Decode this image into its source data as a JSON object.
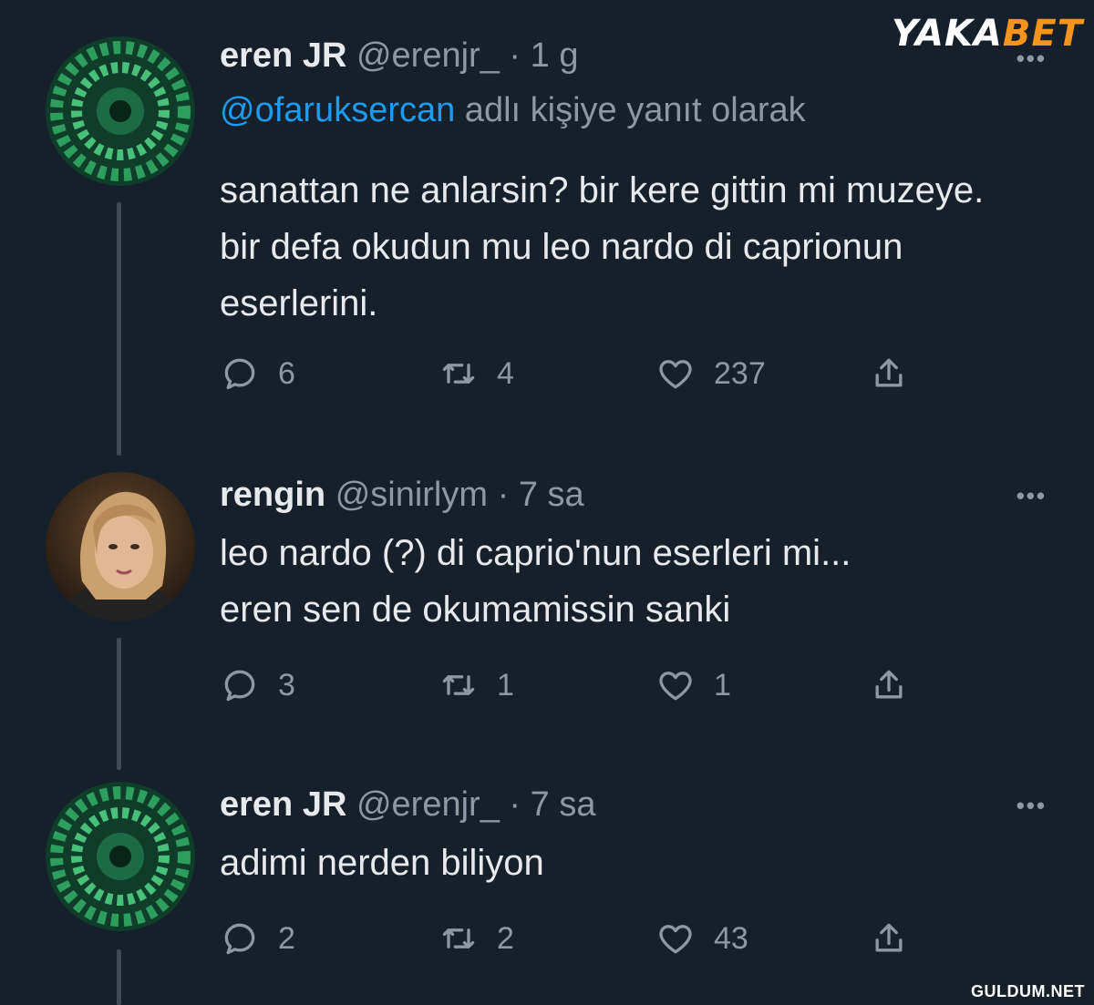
{
  "brand": {
    "logo_white": "YAKA",
    "logo_orange": "BET",
    "accent": "#f7941d"
  },
  "watermark": "GULDUM.NET",
  "colors": {
    "background": "#15202b",
    "mention": "#1d9bf0",
    "muted": "#8b98a5",
    "text": "#e7e9ea"
  },
  "tweets": [
    {
      "name": "eren JR",
      "handle": "@erenjr_",
      "sep": "·",
      "time": "1 g",
      "reply_prefix": "@ofaruksercan",
      "reply_suffix": " adlı kişiye yanıt olarak",
      "text": "sanattan ne anlarsin? bir kere gittin mi muzeye. bir defa okudun mu leo nardo di caprionun eserlerini.",
      "replies": "6",
      "retweets": "4",
      "likes": "237",
      "avatar_icon": "green-spiral-staircase-avatar"
    },
    {
      "name": "rengin",
      "handle": "@sinirlym",
      "sep": "·",
      "time": "7 sa",
      "text_line1": "leo nardo (?) di caprio'nun eserleri mi...",
      "text_line2": "eren sen de okumamissin sanki",
      "replies": "3",
      "retweets": "1",
      "likes": "1",
      "avatar_icon": "profile-photo-avatar"
    },
    {
      "name": "eren JR",
      "handle": "@erenjr_",
      "sep": "·",
      "time": "7 sa",
      "text": "adimi nerden biliyon",
      "replies": "2",
      "retweets": "2",
      "likes": "43",
      "avatar_icon": "green-spiral-staircase-avatar"
    }
  ],
  "more_label": "•••"
}
